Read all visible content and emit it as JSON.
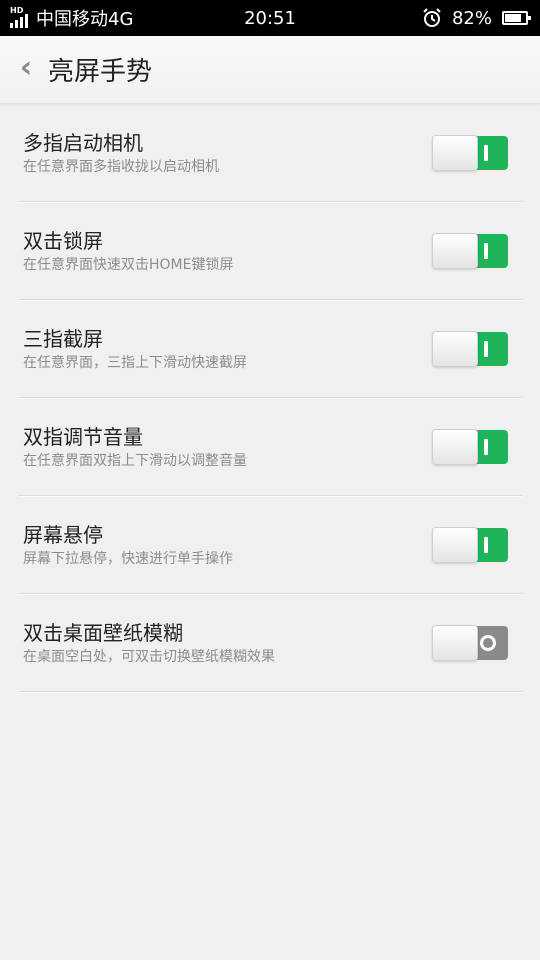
{
  "status_bar": {
    "hd_label": "HD",
    "carrier": "中国移动4G",
    "time": "20:51",
    "battery": "82%",
    "battery_level": 0.82,
    "icons": [
      "signal-icon",
      "alarm-icon",
      "battery-icon"
    ]
  },
  "header": {
    "back_icon": "‹",
    "title": "亮屏手势"
  },
  "settings": [
    {
      "title": "多指启动相机",
      "desc": "在任意界面多指收拢以启动相机",
      "enabled": true
    },
    {
      "title": "双击锁屏",
      "desc": "在任意界面快速双击HOME键锁屏",
      "enabled": true
    },
    {
      "title": "三指截屏",
      "desc": "在任意界面，三指上下滑动快速截屏",
      "enabled": true
    },
    {
      "title": "双指调节音量",
      "desc": "在任意界面双指上下滑动以调整音量",
      "enabled": true
    },
    {
      "title": "屏幕悬停",
      "desc": "屏幕下拉悬停，快速进行单手操作",
      "enabled": true
    },
    {
      "title": "双击桌面壁纸模糊",
      "desc": "在桌面空白处，可双击切换壁纸模糊效果",
      "enabled": false
    }
  ],
  "colors": {
    "toggle_on": "#1fb35a",
    "toggle_off": "#8a8a8a"
  }
}
